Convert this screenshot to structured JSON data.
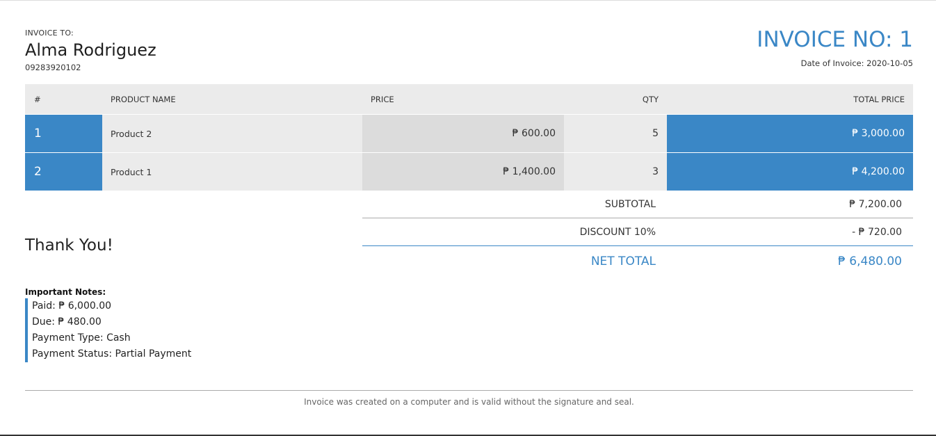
{
  "invoice_to": {
    "label": "INVOICE TO:",
    "name": "Alma Rodriguez",
    "phone": "09283920102"
  },
  "invoice": {
    "number_label": "INVOICE NO: 1",
    "date_label": "Date of Invoice: 2020-10-05"
  },
  "table": {
    "headers": [
      "#",
      "PRODUCT NAME",
      "PRICE",
      "QTY",
      "TOTAL PRICE"
    ],
    "rows": [
      {
        "no": "1",
        "name": "Product 2",
        "price": "₱ 600.00",
        "qty": "5",
        "total": "₱ 3,000.00"
      },
      {
        "no": "2",
        "name": "Product 1",
        "price": "₱ 1,400.00",
        "qty": "3",
        "total": "₱ 4,200.00"
      }
    ]
  },
  "summary": {
    "subtotal_label": "SUBTOTAL",
    "subtotal_value": "₱ 7,200.00",
    "discount_label": "DISCOUNT 10%",
    "discount_value": "- ₱ 720.00",
    "net_label": "NET TOTAL",
    "net_value": "₱ 6,480.00"
  },
  "thanks": "Thank You!",
  "notes": {
    "title": "Important Notes:",
    "items": [
      "Paid: ₱ 6,000.00",
      "Due: ₱ 480.00",
      "Payment Type: Cash",
      "Payment Status: Partial Payment"
    ]
  },
  "footer": "Invoice was created on a computer and is valid without the signature and seal.",
  "colors": {
    "accent": "#3a87c6",
    "header_bg": "#ebebeb",
    "price_bg": "#dcdcdc"
  }
}
